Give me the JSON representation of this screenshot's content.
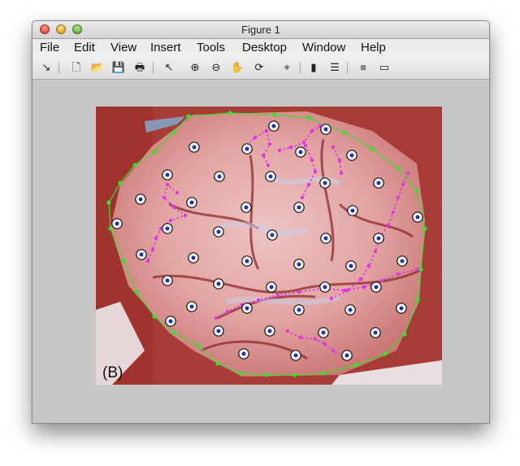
{
  "window": {
    "title": "Figure 1"
  },
  "menubar": {
    "items": [
      "File",
      "Edit",
      "View",
      "Insert",
      "Tools",
      "Desktop",
      "Window",
      "Help"
    ]
  },
  "toolbar": {
    "tools": [
      {
        "name": "dock-arrow-icon",
        "glyph": "↘"
      },
      {
        "name": "new-figure-icon",
        "glyph": "🗋"
      },
      {
        "name": "open-file-icon",
        "glyph": "📂"
      },
      {
        "name": "save-icon",
        "glyph": "💾"
      },
      {
        "name": "print-icon",
        "glyph": "🖶"
      },
      {
        "name": "edit-plot-arrow-icon",
        "glyph": "↖"
      },
      {
        "name": "zoom-in-icon",
        "glyph": "⊕"
      },
      {
        "name": "zoom-out-icon",
        "glyph": "⊖"
      },
      {
        "name": "pan-hand-icon",
        "glyph": "✋"
      },
      {
        "name": "rotate-3d-icon",
        "glyph": "⟳"
      },
      {
        "name": "data-cursor-icon",
        "glyph": "⌖"
      },
      {
        "name": "insert-colorbar-icon",
        "glyph": "▮"
      },
      {
        "name": "insert-legend-icon",
        "glyph": "☰"
      },
      {
        "name": "hide-plot-tools-icon",
        "glyph": "■"
      },
      {
        "name": "show-plot-tools-icon",
        "glyph": "▭"
      }
    ]
  },
  "figure": {
    "panel_label": "(B)",
    "colors": {
      "tissue": "#e2a6a4",
      "vessel": "#8f2a2a",
      "outline": "#39e02f",
      "path": "#e233e6",
      "marker_ring": "#111111",
      "marker_dot": "#1a2fa8"
    }
  }
}
